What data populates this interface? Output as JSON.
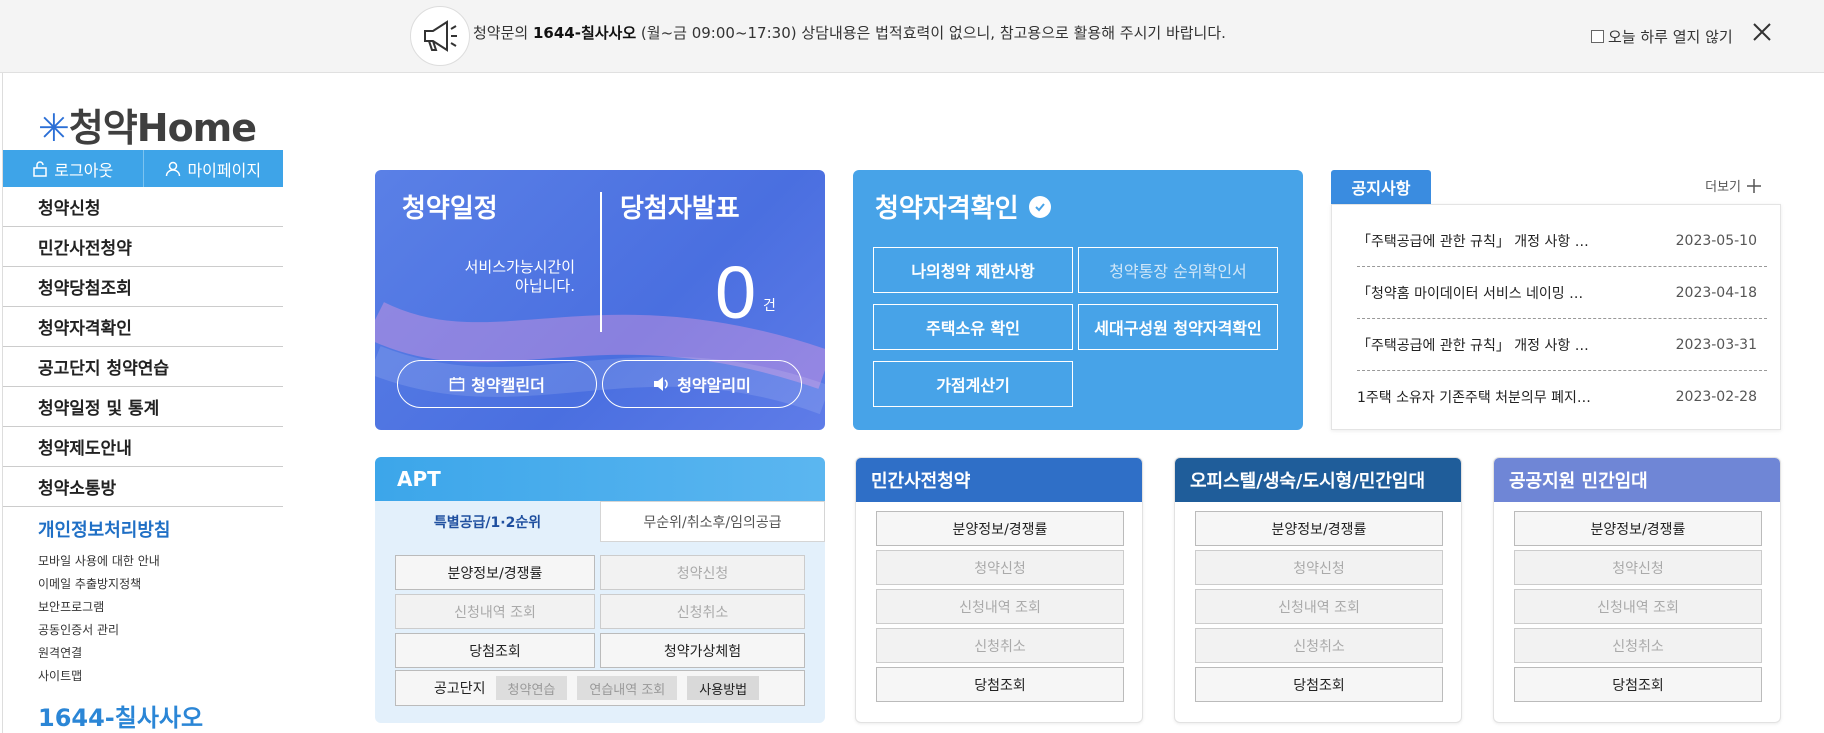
{
  "banner": {
    "text_prefix": "청약문의 ",
    "phone_bold": "1644-칠사사오",
    "hours": " (월~금 09:00~17:30)",
    "disclaimer": " 상담내용은 법적효력이 없으니, 참고용으로 활용해 주시기 바랍니다.",
    "dont_show": "오늘 하루 열지 않기"
  },
  "sidebar": {
    "logo_text": "청약Home",
    "logout": "로그아웃",
    "mypage": "마이페이지",
    "menu": [
      "청약신청",
      "민간사전청약",
      "청약당첨조회",
      "청약자격확인",
      "공고단지 청약연습",
      "청약일정 및 통계",
      "청약제도안내",
      "청약소통방"
    ],
    "privacy_title": "개인정보처리방침",
    "sub_links": [
      "모바일 사용에 대한 안내",
      "이메일 추출방지정책",
      "보안프로그램",
      "공동인증서 관리",
      "원격연결",
      "사이트맵"
    ],
    "phone": "1644-칠사사오"
  },
  "schedule": {
    "title": "청약일정",
    "winners_title": "당첨자발표",
    "message_line1": "서비스가능시간이",
    "message_line2": "아닙니다.",
    "count": "0",
    "unit": "건",
    "calendar_btn": "청약캘린더",
    "alarm_btn": "청약알리미"
  },
  "qualification": {
    "title": "청약자격확인",
    "buttons": [
      "나의청약 제한사항",
      "청약통장 순위확인서",
      "주택소유 확인",
      "세대구성원 청약자격확인",
      "가점계산기"
    ]
  },
  "notices": {
    "tab": "공지사항",
    "more": "더보기",
    "items": [
      {
        "title": "「주택공급에 관한 규칙」 개정 사항 …",
        "date": "2023-05-10"
      },
      {
        "title": "「청약홈 마이데이터 서비스 네이밍 …",
        "date": "2023-04-18"
      },
      {
        "title": "「주택공급에 관한 규칙」 개정 사항 …",
        "date": "2023-03-31"
      },
      {
        "title": "1주택 소유자 기존주택 처분의무 폐지…",
        "date": "2023-02-28"
      }
    ]
  },
  "apt": {
    "title": "APT",
    "tab_active": "특별공급/1·2순위",
    "tab_other": "무순위/취소후/임의공급",
    "buttons": [
      "분양정보/경쟁률",
      "청약신청",
      "신청내역 조회",
      "신청취소",
      "당첨조회",
      "청약가상체험"
    ],
    "practice_label": "공고단지",
    "chips": [
      "청약연습",
      "연습내역 조회",
      "사용방법"
    ]
  },
  "sections": [
    {
      "title": "민간사전청약",
      "color": "#2f6fc7",
      "buttons": [
        "분양정보/경쟁률",
        "청약신청",
        "신청내역 조회",
        "신청취소",
        "당첨조회"
      ]
    },
    {
      "title": "오피스텔/생숙/도시형/민간임대",
      "color": "#1f5d9a",
      "buttons": [
        "분양정보/경쟁률",
        "청약신청",
        "신청내역 조회",
        "신청취소",
        "당첨조회"
      ]
    },
    {
      "title": "공공지원 민간임대",
      "color": "#6f86d6",
      "buttons": [
        "분양정보/경쟁률",
        "청약신청",
        "신청내역 조회",
        "신청취소",
        "당첨조회"
      ]
    }
  ]
}
